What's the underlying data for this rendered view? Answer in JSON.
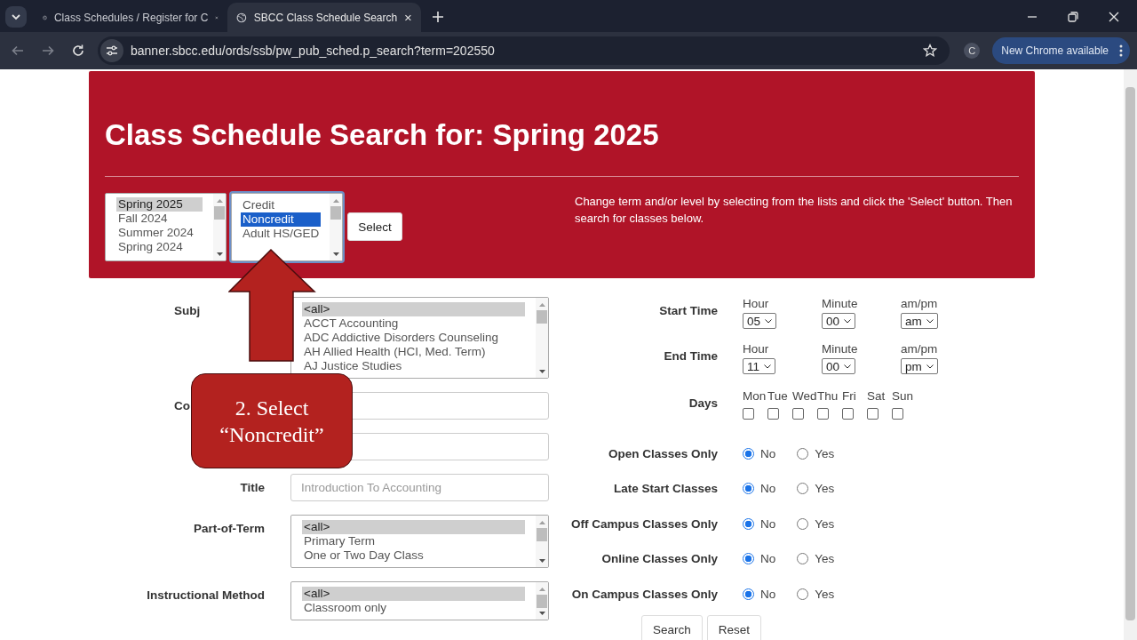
{
  "browser": {
    "tabs": [
      {
        "title": "Class Schedules / Register for C",
        "selected": false
      },
      {
        "title": "SBCC Class Schedule Search",
        "selected": true
      }
    ],
    "url": "banner.sbcc.edu/ords/ssb/pw_pub_sched.p_search?term=202550",
    "profile": "C",
    "update_button": "New Chrome available"
  },
  "banner": {
    "title": "Class Schedule Search for: Spring 2025",
    "term_list": {
      "focused": false,
      "items": [
        {
          "label": "Spring 2025",
          "selected": true
        },
        {
          "label": "Fall 2024",
          "selected": false
        },
        {
          "label": "Summer 2024",
          "selected": false
        },
        {
          "label": "Spring 2024",
          "selected": false
        }
      ]
    },
    "level_list": {
      "focused": true,
      "items": [
        {
          "label": "Credit",
          "selected": false
        },
        {
          "label": "Noncredit",
          "selected": true
        },
        {
          "label": "Adult HS/GED",
          "selected": false
        }
      ]
    },
    "select_button": "Select",
    "instructions": "Change term and/or level by selecting from the lists and click the 'Select' button. Then search for classes below."
  },
  "left_fields": [
    {
      "kind": "listbox",
      "label": "Subj",
      "covered": true,
      "focused": false,
      "items": [
        {
          "label": "<all>",
          "selected": true
        },
        {
          "label": "ACCT Accounting",
          "selected": false
        },
        {
          "label": "ADC Addictive Disorders Counseling",
          "selected": false
        },
        {
          "label": "AH Allied Health (HCI, Med. Term)",
          "selected": false
        },
        {
          "label": "AJ Justice Studies",
          "selected": false
        }
      ]
    },
    {
      "kind": "input",
      "label": "Co",
      "covered": true
    },
    {
      "kind": "input"
    },
    {
      "kind": "input",
      "label": "Title",
      "placeholder": "Introduction To Accounting"
    },
    {
      "kind": "listbox",
      "label": "Part-of-Term",
      "focused": false,
      "items": [
        {
          "label": "<all>",
          "selected": true
        },
        {
          "label": "Primary Term",
          "selected": false
        },
        {
          "label": "One or Two Day Class",
          "selected": false
        }
      ]
    },
    {
      "kind": "listbox",
      "label": "Instructional Method",
      "focused": false,
      "items": [
        {
          "label": "<all>",
          "selected": true
        },
        {
          "label": "Classroom only",
          "selected": false
        }
      ]
    }
  ],
  "time_rows": [
    {
      "label": "Start Time",
      "fields": [
        {
          "caption": "Hour",
          "value": "05"
        },
        {
          "caption": "Minute",
          "value": "00"
        },
        {
          "caption": "am/pm",
          "value": "am"
        }
      ]
    },
    {
      "label": "End Time",
      "fields": [
        {
          "caption": "Hour",
          "value": "11"
        },
        {
          "caption": "Minute",
          "value": "00"
        },
        {
          "caption": "am/pm",
          "value": "pm"
        }
      ]
    }
  ],
  "days": {
    "label": "Days",
    "items": [
      {
        "label": "Mon",
        "checked": false
      },
      {
        "label": "Tue",
        "checked": false
      },
      {
        "label": "Wed",
        "checked": false
      },
      {
        "label": "Thu",
        "checked": false
      },
      {
        "label": "Fri",
        "checked": false
      },
      {
        "label": "Sat",
        "checked": false
      },
      {
        "label": "Sun",
        "checked": false
      }
    ]
  },
  "radio_rows": [
    {
      "label": "Open Classes Only",
      "options": [
        {
          "label": "No",
          "selected": true
        },
        {
          "label": "Yes",
          "selected": false
        }
      ]
    },
    {
      "label": "Late Start Classes",
      "options": [
        {
          "label": "No",
          "selected": true
        },
        {
          "label": "Yes",
          "selected": false
        }
      ]
    },
    {
      "label": "Off Campus Classes Only",
      "options": [
        {
          "label": "No",
          "selected": true
        },
        {
          "label": "Yes",
          "selected": false
        }
      ]
    },
    {
      "label": "Online Classes Only",
      "options": [
        {
          "label": "No",
          "selected": true
        },
        {
          "label": "Yes",
          "selected": false
        }
      ]
    },
    {
      "label": "On Campus Classes Only",
      "options": [
        {
          "label": "No",
          "selected": true
        },
        {
          "label": "Yes",
          "selected": false
        }
      ]
    }
  ],
  "buttons": [
    "Search",
    "Reset"
  ],
  "annotation": {
    "text": "2. Select “Noncredit”"
  }
}
